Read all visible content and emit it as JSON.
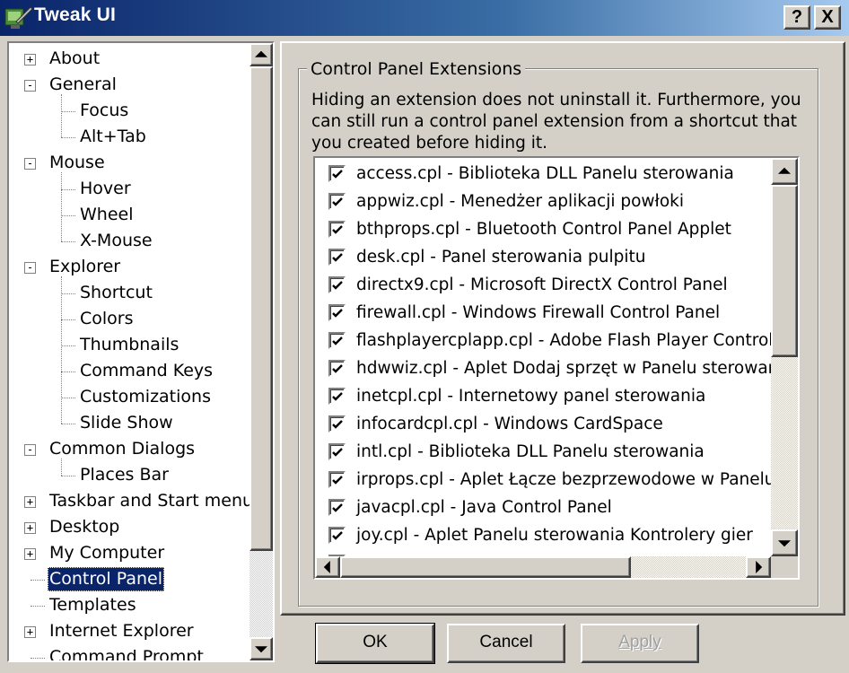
{
  "window": {
    "title": "Tweak UI",
    "help_glyph": "?",
    "close_glyph": "X"
  },
  "tree": {
    "items": [
      {
        "label": "About",
        "expander": "+"
      },
      {
        "label": "General",
        "expander": "-"
      },
      {
        "label": "Focus"
      },
      {
        "label": "Alt+Tab"
      },
      {
        "label": "Mouse",
        "expander": "-"
      },
      {
        "label": "Hover"
      },
      {
        "label": "Wheel"
      },
      {
        "label": "X-Mouse"
      },
      {
        "label": "Explorer",
        "expander": "-"
      },
      {
        "label": "Shortcut"
      },
      {
        "label": "Colors"
      },
      {
        "label": "Thumbnails"
      },
      {
        "label": "Command Keys"
      },
      {
        "label": "Customizations"
      },
      {
        "label": "Slide Show"
      },
      {
        "label": "Common Dialogs",
        "expander": "-"
      },
      {
        "label": "Places Bar"
      },
      {
        "label": "Taskbar and Start menu",
        "expander": "+"
      },
      {
        "label": "Desktop",
        "expander": "+"
      },
      {
        "label": "My Computer",
        "expander": "+"
      },
      {
        "label": "Control Panel",
        "selected": true
      },
      {
        "label": "Templates"
      },
      {
        "label": "Internet Explorer",
        "expander": "+"
      },
      {
        "label": "Command Prompt"
      }
    ]
  },
  "panel": {
    "group_title": "Control Panel Extensions",
    "description": "Hiding an extension does not uninstall it. Furthermore, you can still run a control panel extension from a shortcut that you created before hiding it.",
    "extensions": [
      {
        "label": "access.cpl - Biblioteka DLL Panelu sterowania",
        "checked": true
      },
      {
        "label": "appwiz.cpl - Menedżer aplikacji powłoki",
        "checked": true
      },
      {
        "label": "bthprops.cpl - Bluetooth Control Panel Applet",
        "checked": true
      },
      {
        "label": "desk.cpl - Panel sterowania pulpitu",
        "checked": true
      },
      {
        "label": "directx9.cpl - Microsoft DirectX Control Panel",
        "checked": true
      },
      {
        "label": "firewall.cpl - Windows Firewall Control Panel",
        "checked": true
      },
      {
        "label": "flashplayercplapp.cpl - Adobe Flash Player Control Panel",
        "checked": true
      },
      {
        "label": "hdwwiz.cpl - Aplet Dodaj sprzęt w Panelu sterowania",
        "checked": true
      },
      {
        "label": "inetcpl.cpl - Internetowy panel sterowania",
        "checked": true
      },
      {
        "label": "infocardcpl.cpl - Windows CardSpace",
        "checked": true
      },
      {
        "label": "intl.cpl - Biblioteka DLL Panelu sterowania",
        "checked": true
      },
      {
        "label": "irprops.cpl - Aplet Łącze bezprzewodowe w Panelu sterowania",
        "checked": true
      },
      {
        "label": "javacpl.cpl - Java Control Panel",
        "checked": true
      },
      {
        "label": "joy.cpl - Aplet Panelu sterowania Kontrolery gier",
        "checked": true
      }
    ]
  },
  "buttons": {
    "ok": "OK",
    "cancel": "Cancel",
    "apply": "Apply"
  },
  "colors": {
    "face": "#d4d0c8",
    "selection": "#0a246a",
    "title_start": "#0a246a",
    "title_end": "#a6caf0"
  }
}
